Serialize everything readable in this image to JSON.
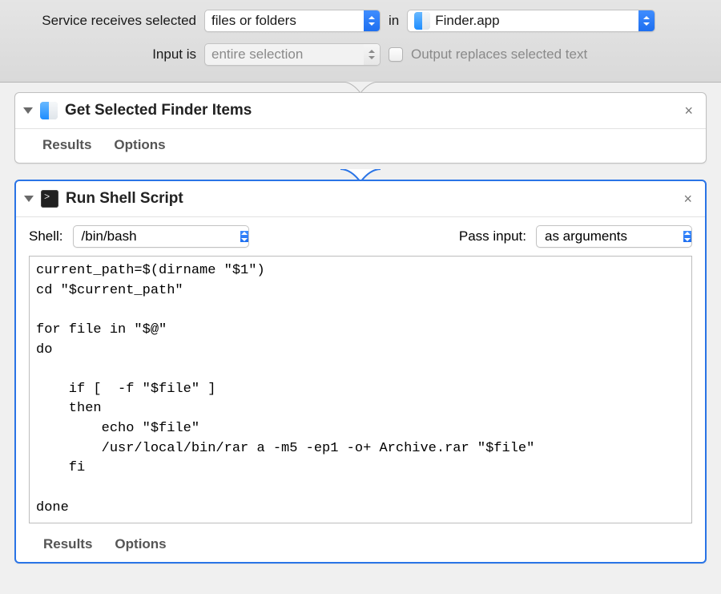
{
  "config": {
    "receives_label": "Service receives selected",
    "receives_value": "files or folders",
    "in_label": "in",
    "app_value": "Finder.app",
    "input_is_label": "Input is",
    "input_is_value": "entire selection",
    "output_replaces_label": "Output replaces selected text",
    "output_replaces_checked": false
  },
  "actions": [
    {
      "id": "get-selected-finder-items",
      "icon": "finder-icon",
      "title": "Get Selected Finder Items",
      "footer": {
        "results": "Results",
        "options": "Options"
      }
    },
    {
      "id": "run-shell-script",
      "icon": "terminal-icon",
      "title": "Run Shell Script",
      "selected": true,
      "shell_label": "Shell:",
      "shell_value": "/bin/bash",
      "pass_input_label": "Pass input:",
      "pass_input_value": "as arguments",
      "script": "current_path=$(dirname \"$1\")\ncd \"$current_path\"\n\nfor file in \"$@\"\ndo\n\n    if [  -f \"$file\" ]\n    then\n        echo \"$file\"\n        /usr/local/bin/rar a -m5 -ep1 -o+ Archive.rar \"$file\"\n    fi\n\ndone",
      "footer": {
        "results": "Results",
        "options": "Options"
      }
    }
  ]
}
